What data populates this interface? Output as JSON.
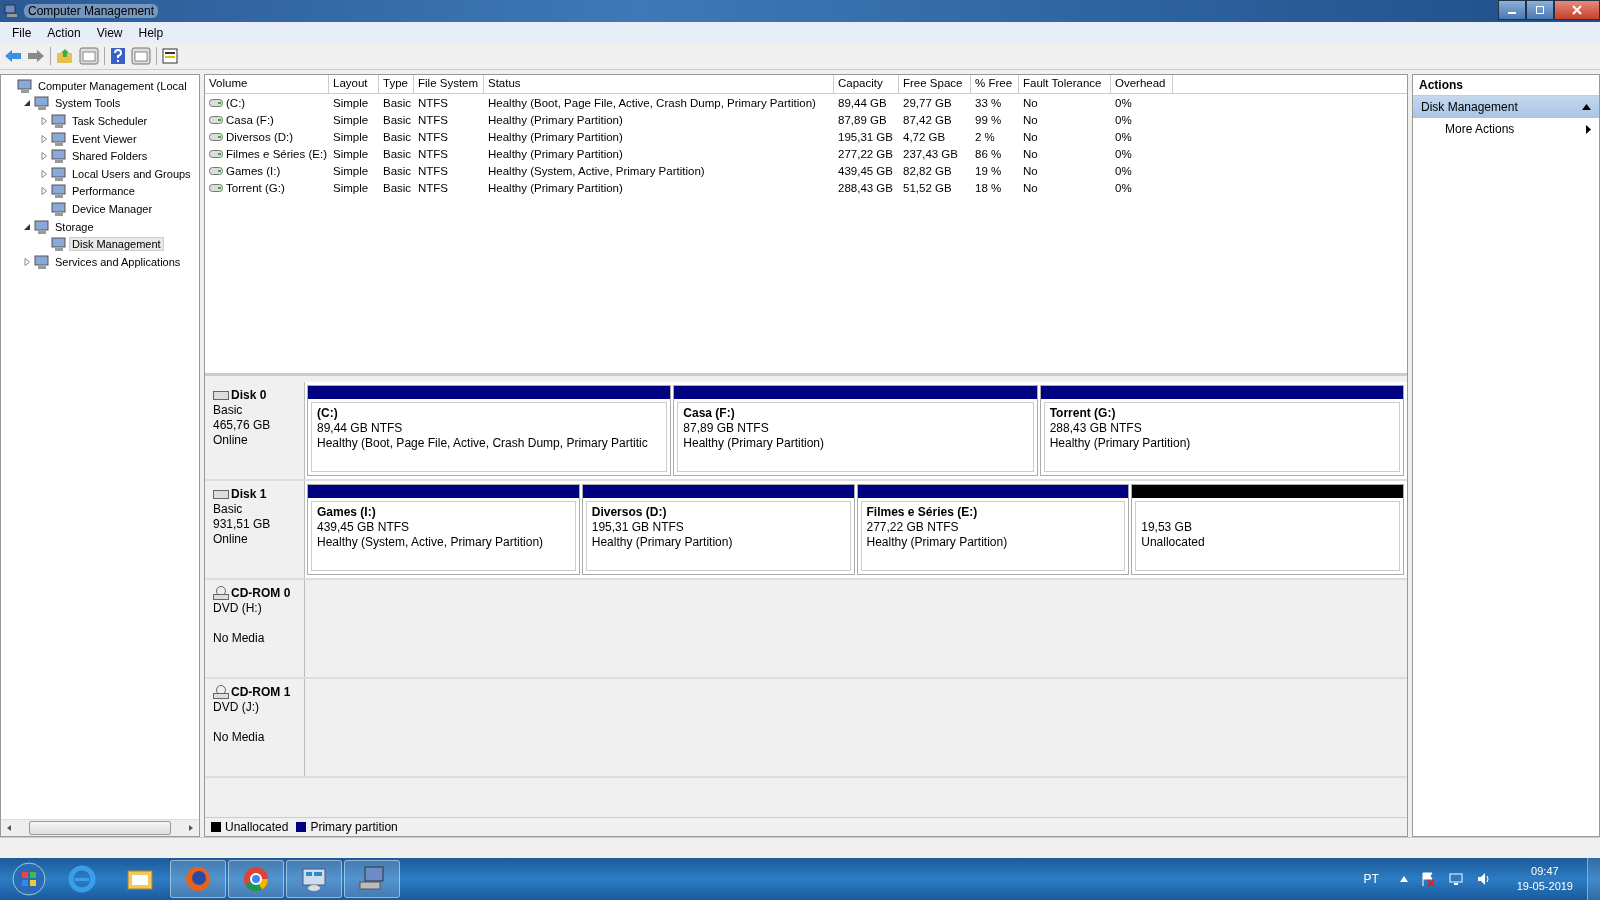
{
  "window": {
    "title": "Computer Management"
  },
  "menu": [
    "File",
    "Action",
    "View",
    "Help"
  ],
  "tree": [
    {
      "label": "Computer Management (Local",
      "selected": false,
      "children": [
        {
          "label": "System Tools",
          "expanded": true,
          "selected": false,
          "children": [
            {
              "label": "Task Scheduler",
              "expanded": false,
              "selected": false
            },
            {
              "label": "Event Viewer",
              "expanded": false,
              "selected": false
            },
            {
              "label": "Shared Folders",
              "expanded": false,
              "selected": false
            },
            {
              "label": "Local Users and Groups",
              "expanded": false,
              "selected": false
            },
            {
              "label": "Performance",
              "expanded": false,
              "selected": false
            },
            {
              "label": "Device Manager",
              "selected": false
            }
          ]
        },
        {
          "label": "Storage",
          "expanded": true,
          "selected": false,
          "children": [
            {
              "label": "Disk Management",
              "selected": true
            }
          ]
        },
        {
          "label": "Services and Applications",
          "expanded": false,
          "selected": false
        }
      ]
    }
  ],
  "table": {
    "columns": [
      "Volume",
      "Layout",
      "Type",
      "File System",
      "Status",
      "Capacity",
      "Free Space",
      "% Free",
      "Fault Tolerance",
      "Overhead"
    ],
    "rows": [
      [
        "(C:)",
        "Simple",
        "Basic",
        "NTFS",
        "Healthy (Boot, Page File, Active, Crash Dump, Primary Partition)",
        "89,44 GB",
        "29,77 GB",
        "33 %",
        "No",
        "0%"
      ],
      [
        "Casa (F:)",
        "Simple",
        "Basic",
        "NTFS",
        "Healthy (Primary Partition)",
        "87,89 GB",
        "87,42 GB",
        "99 %",
        "No",
        "0%"
      ],
      [
        "Diversos (D:)",
        "Simple",
        "Basic",
        "NTFS",
        "Healthy (Primary Partition)",
        "195,31 GB",
        "4,72 GB",
        "2 %",
        "No",
        "0%"
      ],
      [
        "Filmes e Séries (E:)",
        "Simple",
        "Basic",
        "NTFS",
        "Healthy (Primary Partition)",
        "277,22 GB",
        "237,43 GB",
        "86 %",
        "No",
        "0%"
      ],
      [
        "Games (I:)",
        "Simple",
        "Basic",
        "NTFS",
        "Healthy (System, Active, Primary Partition)",
        "439,45 GB",
        "82,82 GB",
        "19 %",
        "No",
        "0%"
      ],
      [
        "Torrent (G:)",
        "Simple",
        "Basic",
        "NTFS",
        "Healthy (Primary Partition)",
        "288,43 GB",
        "51,52 GB",
        "18 %",
        "No",
        "0%"
      ]
    ]
  },
  "disks": [
    {
      "kind": "disk",
      "name": "Disk 0",
      "lines": [
        "Basic",
        "465,76 GB",
        "Online"
      ],
      "partitions": [
        {
          "kind": "primary",
          "name": "(C:)",
          "size": "89,44 GB NTFS",
          "status": "Healthy (Boot, Page File, Active, Crash Dump, Primary Partitic"
        },
        {
          "kind": "primary",
          "name": "Casa  (F:)",
          "size": "87,89 GB NTFS",
          "status": "Healthy (Primary Partition)"
        },
        {
          "kind": "primary",
          "name": "Torrent  (G:)",
          "size": "288,43 GB NTFS",
          "status": "Healthy (Primary Partition)"
        }
      ]
    },
    {
      "kind": "disk",
      "name": "Disk 1",
      "lines": [
        "Basic",
        "931,51 GB",
        "Online"
      ],
      "partitions": [
        {
          "kind": "primary",
          "name": "Games  (I:)",
          "size": "439,45 GB NTFS",
          "status": "Healthy (System, Active, Primary Partition)"
        },
        {
          "kind": "primary",
          "name": "Diversos  (D:)",
          "size": "195,31 GB NTFS",
          "status": "Healthy (Primary Partition)"
        },
        {
          "kind": "primary",
          "name": "Filmes e Séries  (E:)",
          "size": "277,22 GB NTFS",
          "status": "Healthy (Primary Partition)"
        },
        {
          "kind": "unallocated",
          "size": "19,53 GB",
          "status": "Unallocated"
        }
      ]
    },
    {
      "kind": "cdrom",
      "name": "CD-ROM 0",
      "lines": [
        "DVD (H:)",
        "No Media"
      ]
    },
    {
      "kind": "cdrom",
      "name": "CD-ROM 1",
      "lines": [
        "DVD (J:)",
        "No Media"
      ]
    }
  ],
  "legend": [
    {
      "label": "Unallocated",
      "color": "#000000"
    },
    {
      "label": "Primary partition",
      "color": "#000080"
    }
  ],
  "actions": {
    "title": "Actions",
    "section": "Disk Management",
    "items": [
      "More Actions"
    ]
  },
  "taskbar": {
    "apps": [
      {
        "kind": "ie",
        "open": false
      },
      {
        "kind": "folder",
        "open": false
      },
      {
        "kind": "firefox",
        "open": true
      },
      {
        "kind": "chrome",
        "open": true
      },
      {
        "kind": "panel",
        "open": true
      },
      {
        "kind": "mmc",
        "open": true
      }
    ],
    "language": "PT",
    "time": "09:47",
    "date": "19-05-2019"
  }
}
